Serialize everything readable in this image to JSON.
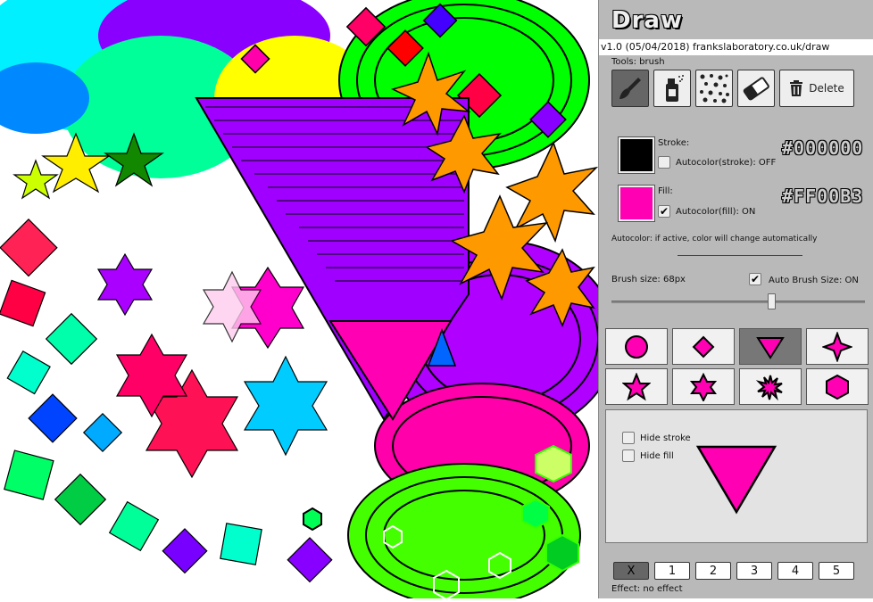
{
  "app": {
    "title": "Draw",
    "version_text": "v1.0 (05/04/2018) frankslaboratory.co.uk/draw"
  },
  "tools": {
    "label": "Tools: brush",
    "items": [
      {
        "name": "brush",
        "icon": "paintbrush-icon",
        "active": true
      },
      {
        "name": "spray",
        "icon": "spray-can-icon",
        "active": false
      },
      {
        "name": "dots",
        "icon": "dots-pattern-icon",
        "active": false
      },
      {
        "name": "eraser",
        "icon": "eraser-icon",
        "active": false
      }
    ],
    "delete_label": "Delete"
  },
  "stroke": {
    "label": "Stroke:",
    "color": "#000000",
    "hex_display": "#000000",
    "autocolor_label": "Autocolor(stroke): OFF",
    "autocolor_checked": false
  },
  "fill": {
    "label": "Fill:",
    "color": "#FF00B3",
    "hex_display": "#FF00B3",
    "autocolor_label": "Autocolor(fill): ON",
    "autocolor_checked": true
  },
  "autocolor_note": "Autocolor: if active, color will change automatically",
  "brush": {
    "size_label": "Brush size: 68px",
    "auto_size_label": "Auto Brush Size: ON",
    "auto_size_checked": true,
    "slider_value_fraction": 0.63
  },
  "shapes": [
    {
      "name": "circle",
      "active": false
    },
    {
      "name": "diamond",
      "active": false
    },
    {
      "name": "triangle-down",
      "active": true
    },
    {
      "name": "four-point-star",
      "active": false
    },
    {
      "name": "five-point-star",
      "active": false
    },
    {
      "name": "six-point-star",
      "active": false
    },
    {
      "name": "burst-star",
      "active": false
    },
    {
      "name": "hexagon",
      "active": false
    }
  ],
  "preview": {
    "hide_stroke_label": "Hide stroke",
    "hide_fill_label": "Hide fill"
  },
  "effects": {
    "buttons": [
      "X",
      "1",
      "2",
      "3",
      "4",
      "5"
    ],
    "active_index": 0,
    "status": "Effect: no effect"
  },
  "colors": {
    "accent": "#FF00B3",
    "panel_bg": "#b9b9b9"
  }
}
